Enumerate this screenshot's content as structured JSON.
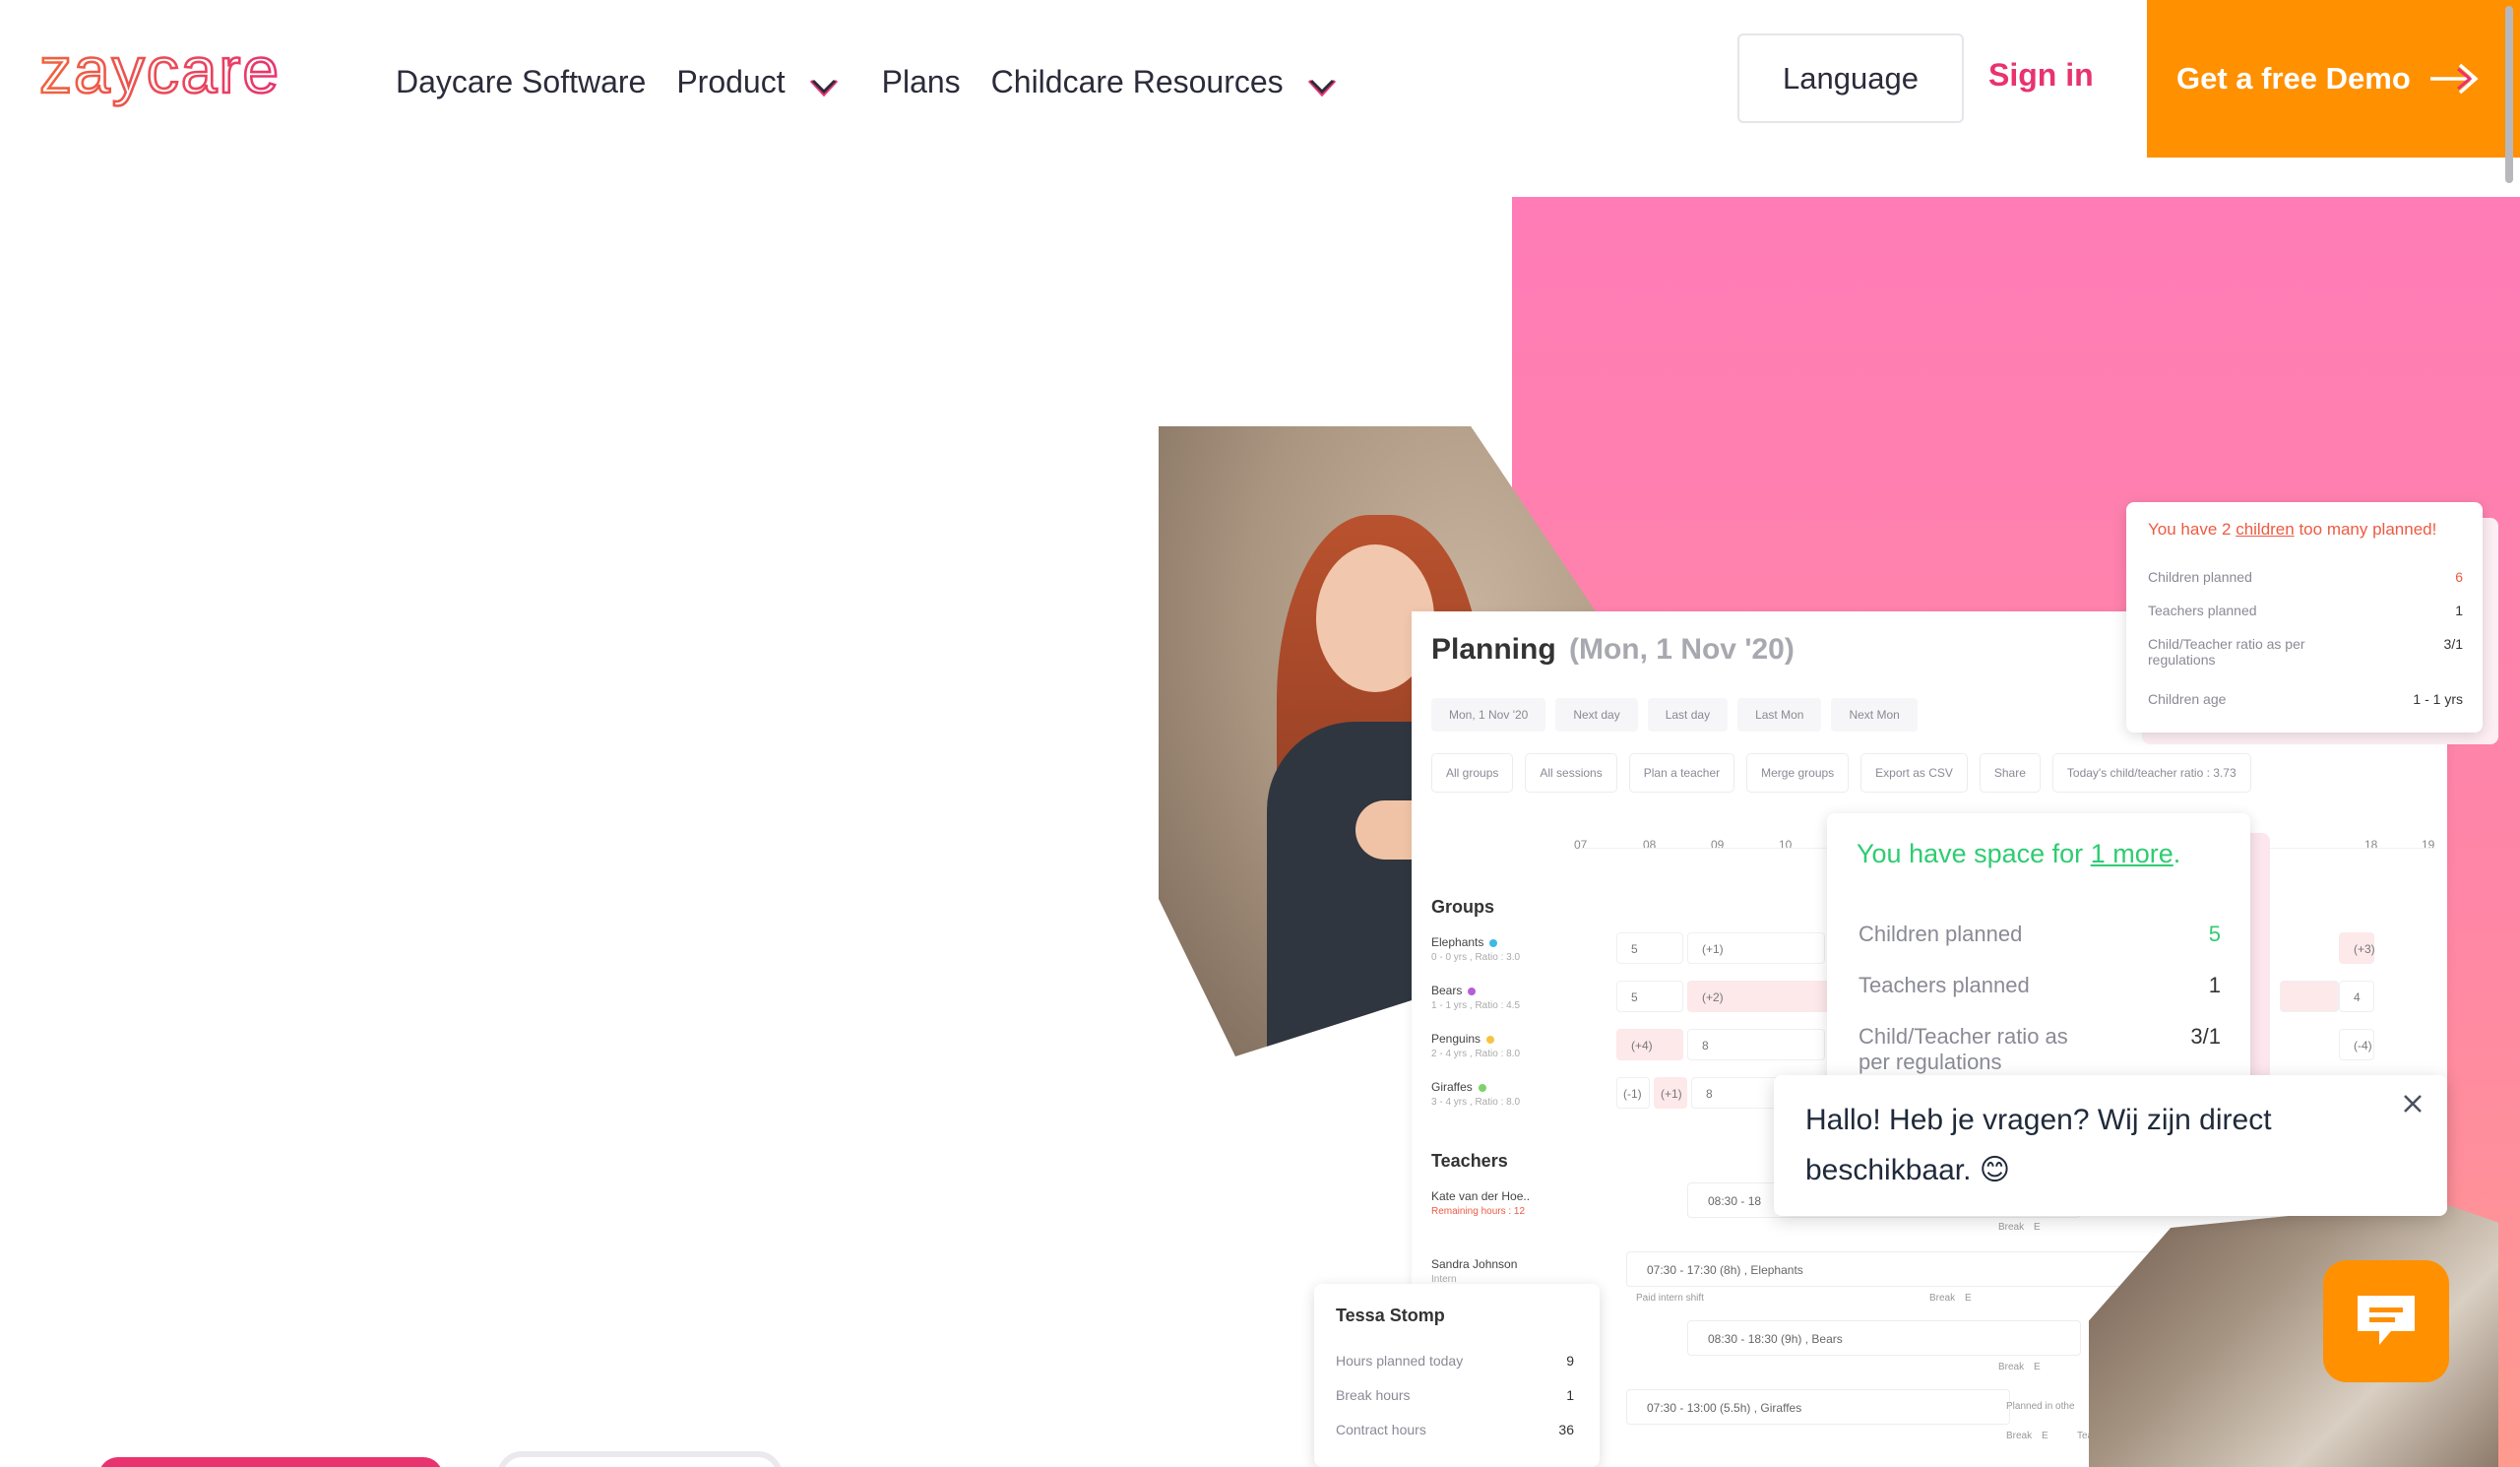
{
  "header": {
    "logo_text": "zaycare",
    "nav": [
      {
        "label": "Daycare Software"
      },
      {
        "label": "Product"
      },
      {
        "label": "Plans"
      },
      {
        "label": "Childcare Resources"
      }
    ],
    "language_label": "Language",
    "signin_label": "Sign in",
    "demo_label": "Get a free Demo"
  },
  "colors": {
    "brand_pink": "#e8336f",
    "brand_orange": "#ff9000",
    "success_green": "#2ecc71",
    "warn_red": "#ee5a42"
  },
  "planning": {
    "title": "Planning",
    "date": "(Mon, 1 Nov '20)",
    "toolbar_top": [
      "Mon, 1 Nov '20",
      "Next day",
      "Last day",
      "Last Mon",
      "Next Mon"
    ],
    "toolbar_bottom": [
      "All groups",
      "All sessions",
      "Plan a teacher",
      "Merge groups",
      "Export as CSV",
      "Share",
      "Today's child/teacher ratio : 3.73"
    ],
    "hours": [
      "07",
      "08",
      "09",
      "10",
      "18",
      "19"
    ],
    "groups_label": "Groups",
    "groups": [
      {
        "name": "Elephants",
        "meta": "0 - 0 yrs , Ratio : 3.0",
        "color": "#3fb9e6",
        "c1": "5",
        "c2": "(+1)",
        "right": "(+3)"
      },
      {
        "name": "Bears",
        "meta": "1 - 1 yrs , Ratio : 4.5",
        "color": "#b460d3",
        "c1": "5",
        "c2": "(+2)",
        "right": "4"
      },
      {
        "name": "Penguins",
        "meta": "2 - 4 yrs , Ratio : 8.0",
        "color": "#f6c342",
        "c1": "(+4)",
        "c2": "8",
        "right": "(-4)"
      },
      {
        "name": "Giraffes",
        "meta": "3 - 4 yrs , Ratio : 8.0",
        "color": "#7cd36b",
        "c1": "(-1)",
        "c1b": "(+1)",
        "c2": "8"
      }
    ],
    "teachers_label": "Teachers",
    "teachers": [
      {
        "name": "Kate van der Hoe..",
        "meta": "Remaining hours : 12"
      },
      {
        "name": "Sandra Johnson",
        "meta": "Intern"
      }
    ],
    "shifts": [
      {
        "label": "08:30 - 18"
      },
      {
        "label": "07:30 - 17:30 (8h) , Elephants"
      },
      {
        "label": "08:30 - 18:30 (9h) , Bears"
      },
      {
        "label": "07:30 - 13:00 (5.5h) , Giraffes"
      }
    ],
    "tags": {
      "break": "Break",
      "break_badge": "E",
      "paid_intern": "Paid intern shift",
      "planned_in_other": "Planned in othe",
      "teacher": "Teacher"
    }
  },
  "warning_card": {
    "head_pre": "You have 2 ",
    "head_link": "children",
    "head_post": " too many planned!",
    "rows": [
      {
        "label": "Children planned",
        "value": "6"
      },
      {
        "label": "Teachers planned",
        "value": "1"
      },
      {
        "label": "Child/Teacher ratio as per regulations",
        "value": "3/1"
      },
      {
        "label": "Children age",
        "value": "1 - 1 yrs"
      }
    ]
  },
  "space_card": {
    "head_pre": "You have space for ",
    "head_link": "1 more",
    "head_post": ".",
    "rows": [
      {
        "label": "Children planned",
        "value": "5"
      },
      {
        "label": "Teachers planned",
        "value": "1"
      },
      {
        "label": "Child/Teacher ratio as per regulations",
        "value": "3/1"
      }
    ]
  },
  "chat": {
    "message": "Hallo! Heb je vragen? Wij zijn direct beschikbaar. 😊"
  },
  "tessa_card": {
    "name": "Tessa Stomp",
    "rows": [
      {
        "label": "Hours planned today",
        "value": "9"
      },
      {
        "label": "Break hours",
        "value": "1"
      },
      {
        "label": "Contract hours",
        "value": "36"
      }
    ]
  }
}
